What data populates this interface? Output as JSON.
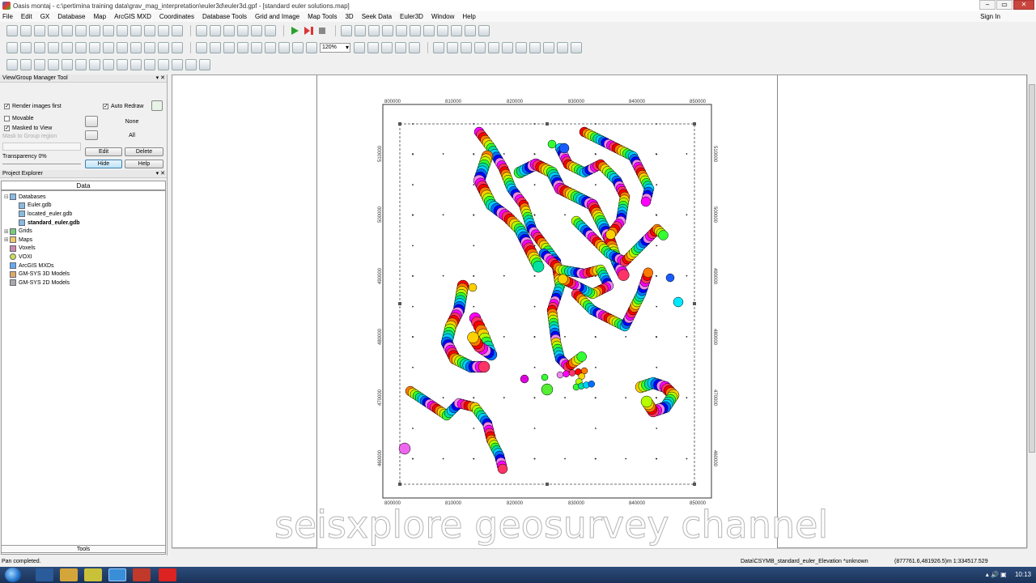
{
  "window": {
    "title": "Oasis montaj - c:\\pertimina training data\\grav_mag_interpretation\\euler3d\\euler3d.gpf - [standard euler solutions.map]"
  },
  "menu": [
    "File",
    "Edit",
    "GX",
    "Database",
    "Map",
    "ArcGIS MXD",
    "Coordinates",
    "Database Tools",
    "Grid and Image",
    "Map Tools",
    "3D",
    "Seek Data",
    "Euler3D",
    "Window",
    "Help"
  ],
  "signin": "Sign In",
  "zoom": "120%",
  "view_group_tool": {
    "title": "View/Group Manager Tool",
    "render_images_first": "Render images first",
    "auto_redraw": "Auto Redraw",
    "movable": "Movable",
    "masked_to_view": "Masked to View",
    "mask_to_group": "Mask to Group region",
    "none": "None",
    "all": "All",
    "transparency": "Transparency 0%",
    "edit": "Edit",
    "delete": "Delete",
    "hide": "Hide",
    "help": "Help"
  },
  "project_explorer": {
    "title": "Project Explorer",
    "tab": "Data",
    "tree": [
      {
        "label": "Databases",
        "level": 0,
        "icon": "database-icon"
      },
      {
        "label": "Euler.gdb",
        "level": 1,
        "icon": "gdb-icon"
      },
      {
        "label": "located_euler.gdb",
        "level": 1,
        "icon": "gdb-icon"
      },
      {
        "label": "standard_euler.gdb",
        "level": 1,
        "icon": "gdb-icon",
        "bold": true
      },
      {
        "label": "Grids",
        "level": 0,
        "icon": "grid-icon"
      },
      {
        "label": "Maps",
        "level": 0,
        "icon": "map-icon"
      },
      {
        "label": "Voxels",
        "level": 0,
        "icon": "voxel-icon"
      },
      {
        "label": "VOXI",
        "level": 0,
        "icon": "voxi-icon"
      },
      {
        "label": "ArcGIS MXDs",
        "level": 0,
        "icon": "arcgis-icon"
      },
      {
        "label": "GM-SYS 3D Models",
        "level": 0,
        "icon": "gmsys3d-icon"
      },
      {
        "label": "GM-SYS 2D Models",
        "level": 0,
        "icon": "gmsys2d-icon"
      }
    ],
    "tools": "Tools"
  },
  "map": {
    "x_ticks": [
      "800000",
      "810000",
      "820000",
      "830000",
      "840000",
      "850000"
    ],
    "y_ticks_left": [
      "510000",
      "500000",
      "490000",
      "480000",
      "470000",
      "460000"
    ],
    "y_ticks_right": [
      "510000",
      "500000",
      "490000",
      "480000",
      "470000",
      "460000"
    ]
  },
  "status": {
    "message": "Pan completed.",
    "database": "Data\\CSYMB_standard_euler_Elevation  *unknown",
    "coords": "(877761.6,481926.5)m  1:334517.529"
  },
  "taskbar": {
    "time": "10:13"
  },
  "watermark": "seisxplore geosurvey channel"
}
